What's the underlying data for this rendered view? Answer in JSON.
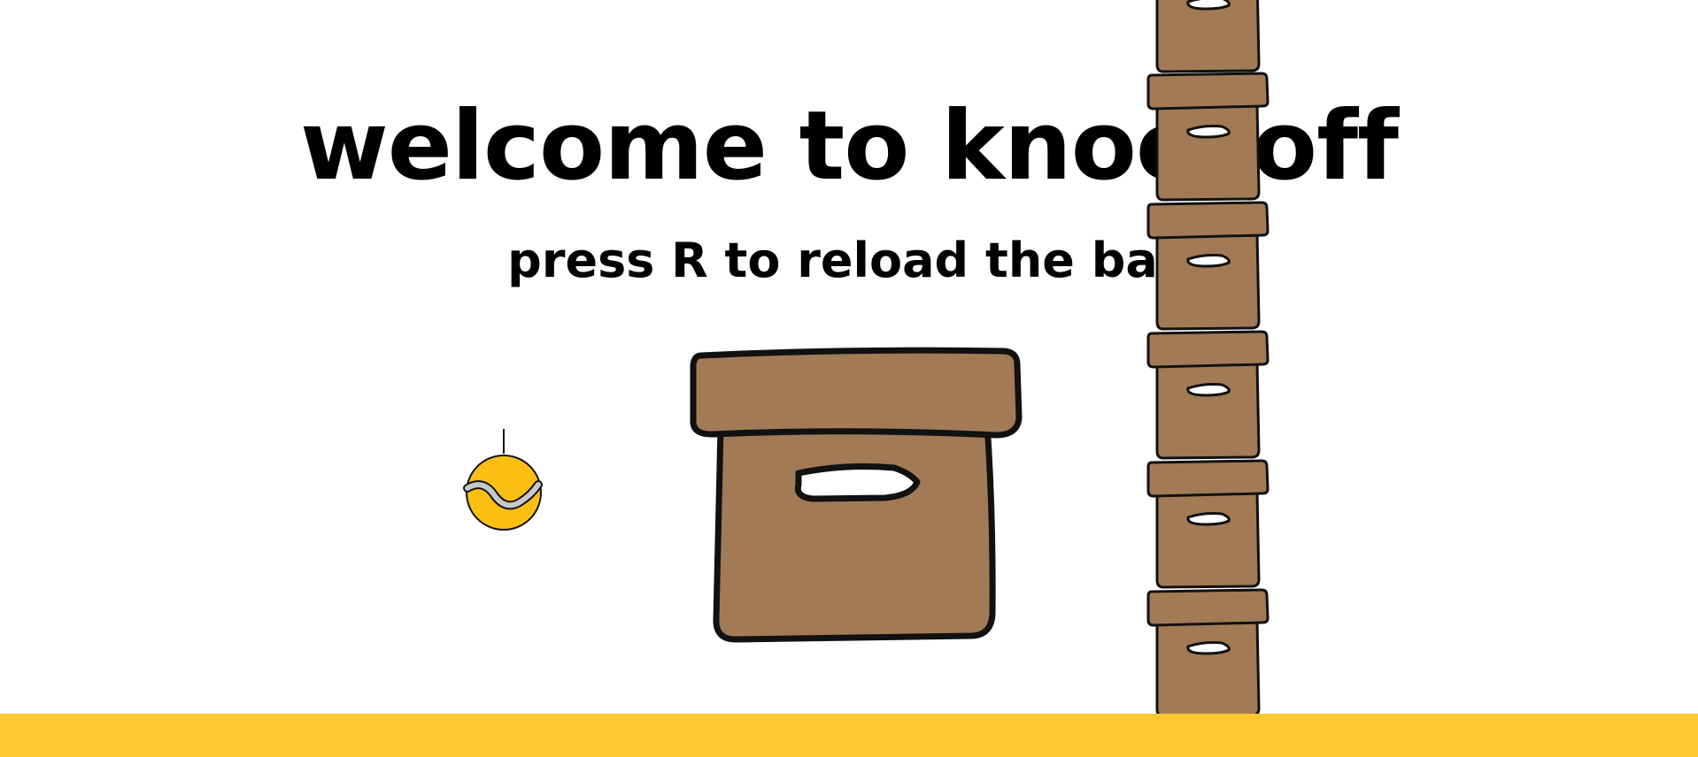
{
  "game": {
    "title": "welcome to knockoff",
    "subtitle": "press R to reload the ball"
  },
  "colors": {
    "background": "#ffffff",
    "ground": "#fdc830",
    "box_fill": "#a37a56",
    "outline": "#111111",
    "handle": "#ffffff",
    "ball": "#fbbf14",
    "ball_seam": "#c8c8c8"
  },
  "scene": {
    "ball": {
      "icon": "tennis-ball-icon",
      "state": "loaded"
    },
    "launcher_box": {
      "icon": "cardboard-box-icon"
    },
    "tower": {
      "icon": "cardboard-box-icon",
      "box_count": 6
    }
  }
}
